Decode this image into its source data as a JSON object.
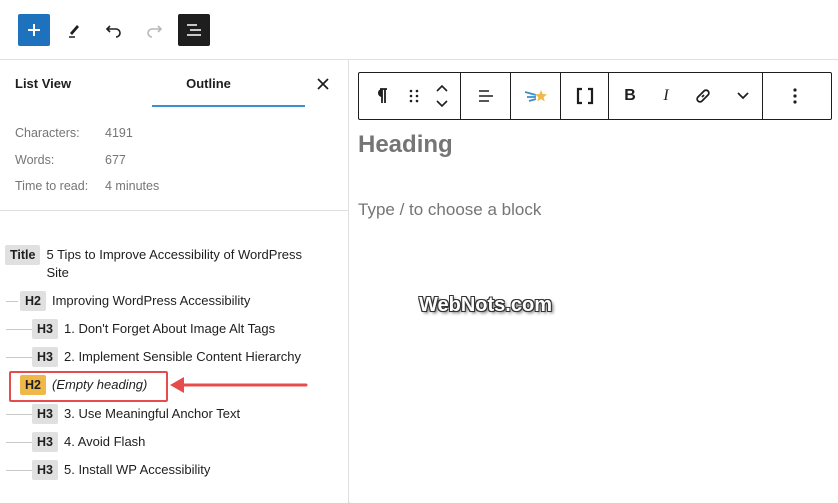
{
  "toolbar": {
    "add_icon": "plus-icon",
    "edit_icon": "pencil-icon",
    "undo_icon": "undo-icon",
    "redo_icon": "redo-icon",
    "document_overview_icon": "document-overview-icon"
  },
  "sidebar": {
    "tabs": [
      "List View",
      "Outline"
    ],
    "active_tab": "Outline",
    "stats": [
      {
        "label": "Characters:",
        "value": "4191"
      },
      {
        "label": "Words:",
        "value": "677"
      },
      {
        "label": "Time to read:",
        "value": "4 minutes"
      }
    ],
    "outline": [
      {
        "level": "Title",
        "text": "5 Tips to Improve Accessibility of WordPress",
        "text2": "Site"
      },
      {
        "level": "H2",
        "text": "Improving WordPress Accessibility"
      },
      {
        "level": "H3",
        "text": "1. Don't Forget About Image Alt Tags"
      },
      {
        "level": "H3",
        "text": "2. Implement Sensible Content Hierarchy"
      },
      {
        "level": "H2",
        "text": "(Empty heading)",
        "warning": true
      },
      {
        "level": "H3",
        "text": "3. Use Meaningful Anchor Text"
      },
      {
        "level": "H3",
        "text": "4. Avoid Flash"
      },
      {
        "level": "H3",
        "text": "5. Install WP Accessibility"
      }
    ]
  },
  "editor": {
    "block_toolbar": {
      "italic_label": "I",
      "bold_label": "B"
    },
    "heading": "Heading",
    "placeholder": "Type / to choose a block",
    "watermark": "WebNots.com"
  },
  "colors": {
    "accent": "#1e72bd",
    "warning_badge": "#f0b849",
    "highlight": "#e74c4c",
    "tab_underline": "#3a8fd0"
  }
}
